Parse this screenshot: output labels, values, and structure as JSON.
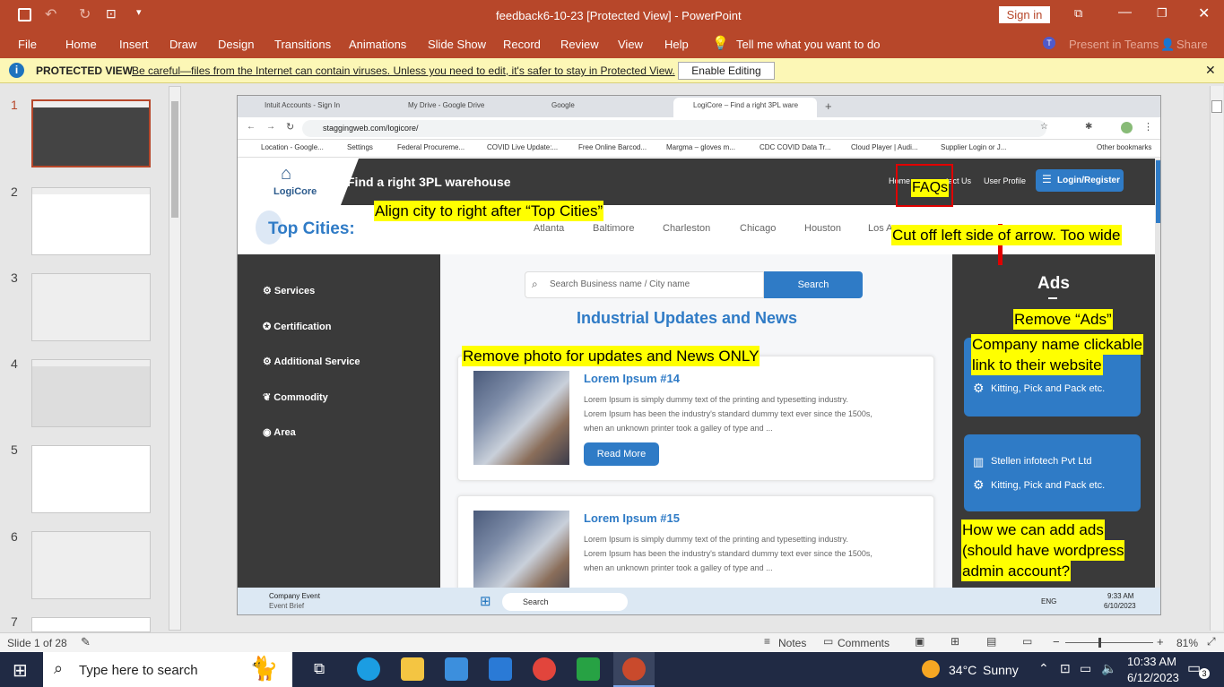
{
  "titlebar": {
    "doc_title": "feedback6-10-23 [Protected View]  -  PowerPoint",
    "signin": "Sign in"
  },
  "ribbon": {
    "tabs": [
      "File",
      "Home",
      "Insert",
      "Draw",
      "Design",
      "Transitions",
      "Animations",
      "Slide Show",
      "Record",
      "Review",
      "View",
      "Help"
    ],
    "tell_me": "Tell me what you want to do",
    "present_teams": "Present in Teams",
    "share": "Share"
  },
  "protected": {
    "label": "PROTECTED VIEW",
    "message": "Be careful—files from the Internet can contain viruses. Unless you need to edit, it's safer to stay in Protected View.",
    "enable_button": "Enable Editing"
  },
  "thumbnails": {
    "numbers": [
      "1",
      "2",
      "3",
      "4",
      "5",
      "6",
      "7"
    ]
  },
  "slide": {
    "browser": {
      "tabs": [
        "Intuit Accounts - Sign In",
        "My Drive - Google Drive",
        "Google",
        "LogiCore – Find a right 3PL ware"
      ],
      "url": "staggingweb.com/logicore/",
      "bookmarks": [
        "Location - Google...",
        "Settings",
        "Federal Procureme...",
        "COVID Live Update:...",
        "Free Online Barcod...",
        "Margma – gloves m...",
        "CDC COVID Data Tr...",
        "Cloud Player | Audi...",
        "Supplier Login or J..."
      ],
      "other_bookmarks": "Other bookmarks"
    },
    "site": {
      "logo_text": "LogiCore",
      "tagline": "Find a right 3PL warehouse",
      "nav_home": "Home",
      "nav_contact": "tact Us",
      "nav_user": "User Profile",
      "login_button": "Login/Register",
      "top_cities": "Top Cities:",
      "cities": [
        "Atlanta",
        "Baltimore",
        "Charleston",
        "Chicago",
        "Houston",
        "Los A"
      ],
      "sidebar": [
        "Services",
        "Certification",
        "Additional Service",
        "Commodity",
        "Area"
      ],
      "search_placeholder": "Search Business name / City name",
      "search_button": "Search",
      "section_title": "Industrial Updates and News",
      "posts": [
        {
          "title": "Lorem Ipsum #14",
          "line1": "Lorem Ipsum is simply dummy text of the printing and typesetting industry.",
          "line2": "Lorem Ipsum has been the industry's standard dummy text ever since the 1500s,",
          "line3": "when an unknown printer took a galley of type and ...",
          "button": "Read More"
        },
        {
          "title": "Lorem Ipsum #15",
          "line1": "Lorem Ipsum is simply dummy text of the printing and typesetting industry.",
          "line2": "Lorem Ipsum has been the industry's standard dummy text ever since the 1500s,",
          "line3": "when an unknown printer took a galley of type and ..."
        }
      ],
      "ads_title": "Ads",
      "ad1_service": "Kitting, Pick and Pack etc.",
      "ad2_company": "Stellen infotech Pvt Ltd",
      "ad2_service": "Kitting, Pick and Pack etc."
    },
    "annotations": {
      "faqs": "FAQs",
      "align_city": "Align city to right after “Top Cities”",
      "cut_arrow": "Cut off left side of arrow. Too wide",
      "remove_ads": "Remove “Ads”",
      "company_link_1": "Company name clickable",
      "company_link_2": "link to their website",
      "remove_photo": "Remove photo for updates and News ONLY",
      "add_ads_1": "How we can add ads",
      "add_ads_2": "(should have wordpress",
      "add_ads_3": "admin account?"
    },
    "inner_taskbar": {
      "event_title": "Company Event",
      "event_sub": "Event Brief",
      "search": "Search",
      "lang": "ENG",
      "time": "9:33 AM",
      "date": "6/10/2023"
    }
  },
  "statusbar": {
    "slide_info": "Slide 1 of 28",
    "notes": "Notes",
    "comments": "Comments",
    "zoom": "81%"
  },
  "taskbar": {
    "search_placeholder": "Type here to search",
    "temp": "34°C",
    "weather": "Sunny",
    "time": "10:33 AM",
    "date": "6/12/2023",
    "notif_count": "3"
  },
  "colors": {
    "ppt_red": "#b7472a",
    "annotation_yellow": "#ffff00",
    "site_blue": "#2f7bc6",
    "site_dark": "#3a3a3a"
  }
}
